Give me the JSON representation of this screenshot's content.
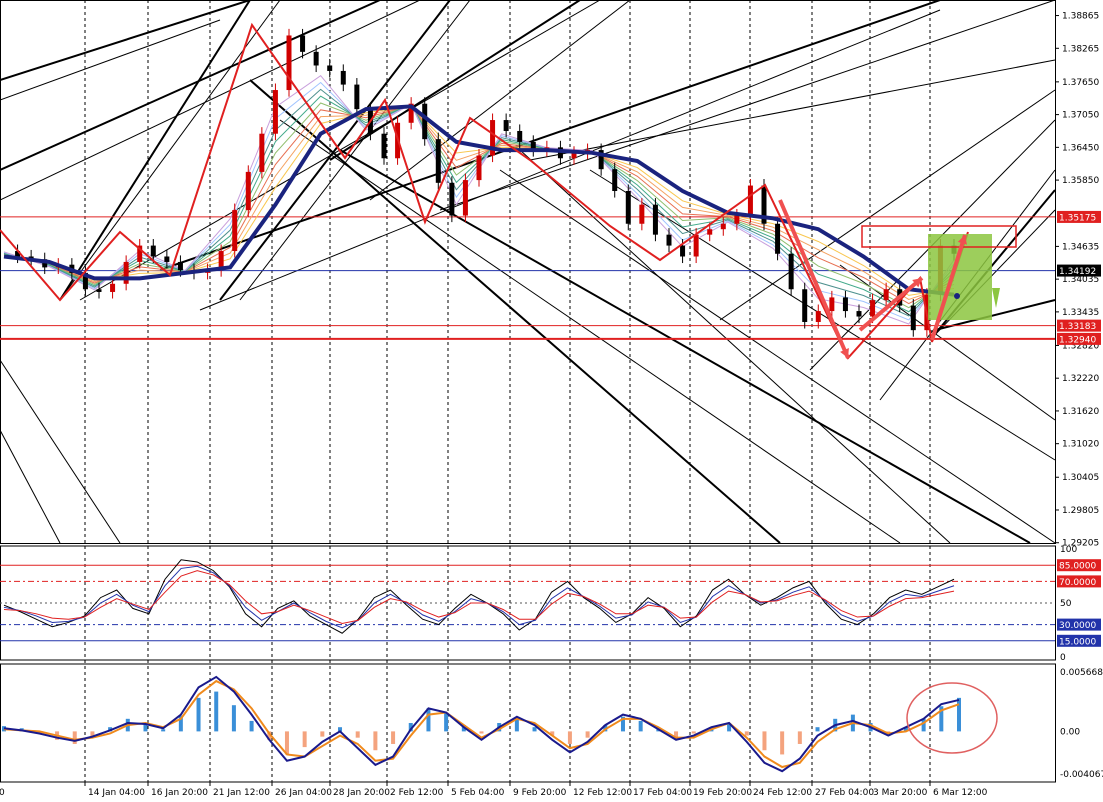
{
  "chart_data": [
    {
      "type": "line",
      "panel": "price",
      "description_visible": "candlestick price chart with moving-average ribbon, trend channels and horizontal levels",
      "x_ticks": [
        "14 Jan 04:00",
        "16 Jan 20:00",
        "21 Jan 12:00",
        "26 Jan 04:00",
        "28 Jan 20:00",
        "2 Feb 12:00",
        "5 Feb 04:00",
        "9 Feb 20:00",
        "12 Feb 12:00",
        "17 Feb 04:00",
        "19 Feb 20:00",
        "24 Feb 12:00",
        "27 Feb 04:00",
        "3 Mar 20:00",
        "6 Mar 12:00"
      ],
      "y_ticks": [
        "1.38865",
        "1.38265",
        "1.37650",
        "1.37050",
        "1.36450",
        "1.35850",
        "1.34635",
        "1.34035",
        "1.33435",
        "1.32820",
        "1.32220",
        "1.31620",
        "1.31020",
        "1.30405",
        "1.29805",
        "1.29205"
      ],
      "ylim": [
        1.292,
        1.3915
      ],
      "levels": [
        {
          "value": 1.35175,
          "label": "1.35175",
          "color": "#e02020"
        },
        {
          "value": 1.34192,
          "label": "1.34192",
          "color": "#2233aa"
        },
        {
          "value": 1.33183,
          "label": "1.33183",
          "color": "#e02020"
        },
        {
          "value": 1.3294,
          "label": "1.32940",
          "color": "#e02020"
        }
      ],
      "series": [
        {
          "name": "",
          "role": "price",
          "color": "#000000",
          "x": [
            0,
            3,
            6,
            9,
            12,
            15,
            18,
            21,
            24,
            27,
            30,
            33,
            36,
            39,
            42,
            45,
            48,
            51,
            54,
            57,
            60,
            63,
            66,
            69,
            72,
            75,
            78,
            81,
            84,
            87,
            90,
            93,
            96,
            99,
            102,
            105,
            108,
            111,
            114,
            117,
            120,
            123,
            126,
            129,
            132,
            135,
            138,
            141,
            144,
            147,
            150,
            153,
            156,
            159,
            162,
            165,
            168,
            171,
            174,
            177,
            180,
            183,
            186,
            189,
            192,
            195,
            198,
            201,
            204,
            207,
            210
          ],
          "values": [
            1.3455,
            1.3445,
            1.344,
            1.3425,
            1.343,
            1.3415,
            1.3385,
            1.338,
            1.3395,
            1.3435,
            1.3465,
            1.3445,
            1.3435,
            1.342,
            1.3415,
            1.342,
            1.3455,
            1.353,
            1.36,
            1.367,
            1.375,
            1.385,
            1.382,
            1.3795,
            1.3785,
            1.376,
            1.3715,
            1.367,
            1.3625,
            1.369,
            1.3725,
            1.366,
            1.358,
            1.352,
            1.3585,
            1.363,
            1.3695,
            1.3675,
            1.3655,
            1.364,
            1.3645,
            1.3625,
            1.3635,
            1.364,
            1.3605,
            1.3565,
            1.3505,
            1.354,
            1.3485,
            1.3465,
            1.3445,
            1.3485,
            1.3495,
            1.3505,
            1.352,
            1.3575,
            1.3505,
            1.345,
            1.3385,
            1.3325,
            1.3345,
            1.337,
            1.3345,
            1.3335,
            1.3365,
            1.3385,
            1.3355,
            1.331,
            1.3375,
            1.3465,
            1.345
          ]
        },
        {
          "name": "",
          "role": "slow-ma",
          "color": "#1a237e",
          "x": [
            0,
            10,
            20,
            30,
            40,
            50,
            60,
            70,
            80,
            90,
            100,
            110,
            120,
            130,
            140,
            150,
            160,
            170,
            180,
            190,
            200,
            210
          ],
          "values": [
            1.3445,
            1.3435,
            1.3405,
            1.3405,
            1.3415,
            1.3425,
            1.354,
            1.367,
            1.3715,
            1.372,
            1.3655,
            1.364,
            1.364,
            1.3635,
            1.362,
            1.3565,
            1.3525,
            1.3515,
            1.3495,
            1.3445,
            1.3385,
            1.3375
          ]
        }
      ]
    },
    {
      "type": "line",
      "panel": "oscillator",
      "ylim": [
        0,
        100
      ],
      "y_ticks": [
        "100",
        "50",
        "0"
      ],
      "levels": [
        {
          "value": 85,
          "label": "85.0000",
          "color": "#e02020"
        },
        {
          "value": 70,
          "label": "70.0000",
          "color": "#e02020"
        },
        {
          "value": 30,
          "label": "30.0000",
          "color": "#2233aa"
        },
        {
          "value": 15,
          "label": "15.0000",
          "color": "#2233aa"
        }
      ],
      "series": [
        {
          "name": "",
          "color": "#000000",
          "values": [
            48,
            42,
            35,
            28,
            32,
            38,
            55,
            62,
            45,
            40,
            72,
            90,
            88,
            80,
            65,
            40,
            28,
            45,
            52,
            38,
            30,
            22,
            35,
            55,
            62,
            48,
            35,
            30,
            45,
            58,
            50,
            40,
            25,
            35,
            60,
            70,
            55,
            45,
            32,
            40,
            55,
            45,
            28,
            38,
            62,
            72,
            58,
            48,
            55,
            64,
            70,
            50,
            35,
            30,
            40,
            55,
            62,
            58,
            65,
            72
          ]
        },
        {
          "name": "",
          "color": "#2233aa",
          "values": [
            46,
            43,
            38,
            32,
            33,
            37,
            50,
            58,
            48,
            42,
            66,
            82,
            84,
            78,
            66,
            46,
            34,
            42,
            50,
            41,
            33,
            27,
            34,
            50,
            58,
            50,
            39,
            33,
            42,
            54,
            50,
            42,
            30,
            34,
            54,
            64,
            56,
            47,
            36,
            39,
            51,
            46,
            32,
            37,
            56,
            66,
            58,
            50,
            53,
            60,
            65,
            52,
            39,
            33,
            38,
            51,
            58,
            56,
            61,
            66
          ]
        },
        {
          "name": "",
          "color": "#e02020",
          "values": [
            44,
            43,
            40,
            36,
            35,
            37,
            46,
            54,
            49,
            44,
            60,
            75,
            80,
            76,
            67,
            52,
            40,
            42,
            48,
            43,
            37,
            31,
            34,
            46,
            54,
            51,
            43,
            37,
            41,
            50,
            50,
            44,
            35,
            35,
            49,
            59,
            56,
            49,
            40,
            40,
            48,
            46,
            36,
            37,
            51,
            61,
            58,
            51,
            52,
            57,
            61,
            53,
            43,
            37,
            38,
            47,
            54,
            55,
            58,
            61
          ]
        }
      ]
    },
    {
      "type": "bar",
      "panel": "macd",
      "ylim": [
        -0.0040674,
        0.0056688
      ],
      "y_ticks": [
        "0.0056688",
        "0.00",
        "-0.0040674"
      ],
      "series": [
        {
          "name": "",
          "role": "histogram",
          "colors": {
            "positive": "#3a8fd8",
            "negative": "#f4a37e"
          },
          "values": [
            0.0005,
            0.0003,
            -0.0002,
            -0.0008,
            -0.0012,
            -0.0006,
            0.0004,
            0.0012,
            0.0008,
            0.0002,
            0.0015,
            0.0032,
            0.0038,
            0.0025,
            0.001,
            -0.0008,
            -0.0022,
            -0.0015,
            -0.0005,
            0.0004,
            -0.0006,
            -0.0018,
            -0.0012,
            0.0008,
            0.0022,
            0.0018,
            0.0006,
            -0.0002,
            0.0008,
            0.0012,
            0.0004,
            -0.0004,
            -0.0012,
            -0.0006,
            0.0006,
            0.0014,
            0.001,
            0.0002,
            -0.0006,
            -0.0002,
            0.0004,
            0.0008,
            -0.0004,
            -0.0018,
            -0.0022,
            -0.0012,
            0.0004,
            0.0012,
            0.0016,
            0.0008,
            -0.0002,
            0.0004,
            0.0012,
            0.0024,
            0.0032
          ]
        },
        {
          "name": "",
          "role": "signal",
          "color": "#f08a1c",
          "values": [
            0.0002,
            0.0001,
            0.0,
            -0.0004,
            -0.0008,
            -0.0006,
            -0.0002,
            0.0006,
            0.0008,
            0.0004,
            0.0012,
            0.0035,
            0.0048,
            0.004,
            0.0022,
            -0.0002,
            -0.0022,
            -0.0024,
            -0.0014,
            -0.0004,
            -0.0012,
            -0.0028,
            -0.0026,
            -0.0004,
            0.0016,
            0.0018,
            0.0006,
            -0.0006,
            0.0002,
            0.0012,
            0.0008,
            -0.0004,
            -0.0016,
            -0.0012,
            0.0002,
            0.0012,
            0.0012,
            0.0004,
            -0.0006,
            -0.0006,
            0.0002,
            0.0008,
            -0.0006,
            -0.0024,
            -0.0034,
            -0.003,
            -0.001,
            0.0002,
            0.0008,
            0.0006,
            -0.0002,
            0.0,
            0.0008,
            0.002,
            0.0026
          ]
        },
        {
          "name": "",
          "role": "macd",
          "color": "#1a1a8c",
          "values": [
            0.0003,
            0.0001,
            -0.0002,
            -0.0006,
            -0.0009,
            -0.0005,
            0.0001,
            0.0008,
            0.0007,
            0.0003,
            0.0016,
            0.0042,
            0.0052,
            0.0038,
            0.0016,
            -0.0008,
            -0.0028,
            -0.0024,
            -0.001,
            0.0,
            -0.0016,
            -0.0032,
            -0.0024,
            0.0002,
            0.0022,
            0.0018,
            0.0004,
            -0.0008,
            0.0004,
            0.0014,
            0.0006,
            -0.0008,
            -0.002,
            -0.001,
            0.0006,
            0.0016,
            0.0012,
            0.0002,
            -0.0008,
            -0.0004,
            0.0004,
            0.0008,
            -0.001,
            -0.003,
            -0.0038,
            -0.0026,
            -0.0004,
            0.0006,
            0.001,
            0.0004,
            -0.0004,
            0.0004,
            0.0012,
            0.0026,
            0.003
          ]
        }
      ]
    }
  ],
  "colors": {
    "grid": "#000000",
    "red": "#e02020",
    "green_box": "#8cc63f",
    "arrow": "#f05050",
    "navy": "#1a237e"
  }
}
